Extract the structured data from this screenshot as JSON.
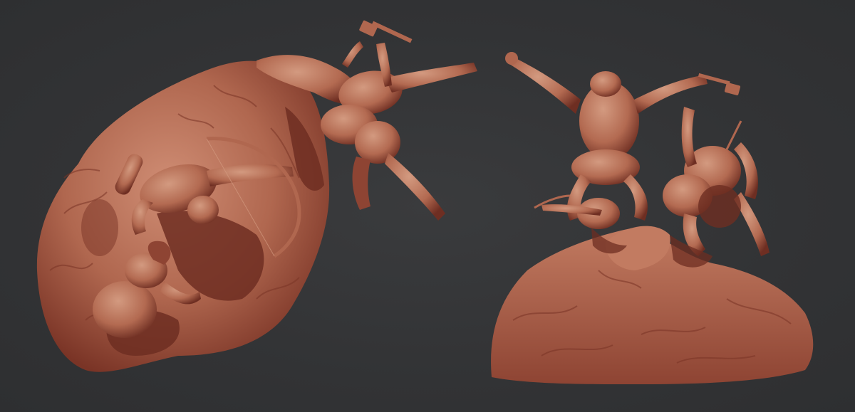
{
  "scene": {
    "background_color": "#323335",
    "clay_color": "#b0674f",
    "clay_shadow_color": "#6e2e22",
    "clay_highlight_color": "#cf8d74",
    "views": [
      {
        "id": "top-down-view"
      },
      {
        "id": "front-view"
      }
    ]
  }
}
